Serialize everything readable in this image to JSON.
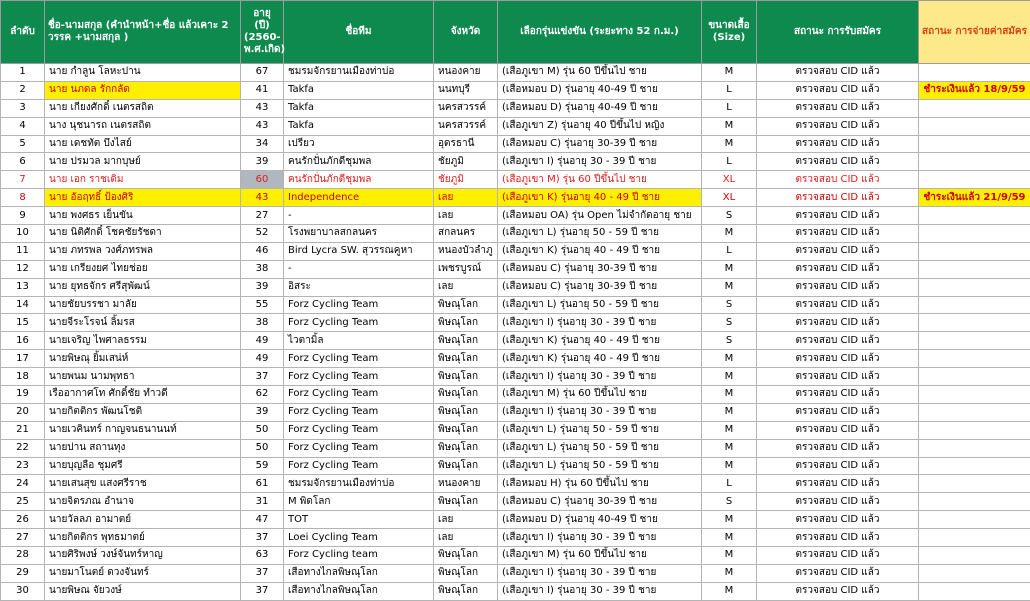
{
  "headers": [
    "ลำดับ",
    "ชื่อ-นามสกุล (คำนำหน้า+ชื่อ แล้วเคาะ 2 วรรค +นามสกุล )",
    "อายุ (ปี) (2560-พ.ศ.เกิด)",
    "ชื่อทีม",
    "จังหวัด",
    "เลือกรุ่นแข่งขัน (ระยะทาง 52 ก.ม.)",
    "ขนาดเสื้อ (Size)",
    "สถานะ การรับสมัคร",
    "สถานะ การจ่ายค่าสมัคร"
  ],
  "rows": [
    {
      "no": "1",
      "name": "นาย กำลูน  โลหะปาน",
      "age": "67",
      "team": "ชมรมจักรยานเมืองท่าบ่อ",
      "province": "หนองคาย",
      "category": "(เสือภูเขา M) รุ่น 60 ปีขึ้นไป ชาย",
      "size": "M",
      "status": "ตรวจสอบ CID แล้ว",
      "payment": "",
      "style": ""
    },
    {
      "no": "2",
      "name": "นาย นภดล  รักกลัด",
      "age": "41",
      "team": "Takfa",
      "province": "นนทบุรี",
      "category": "(เสือหมอบ D) รุ่นอายุ 40-49 ปี ชาย",
      "size": "L",
      "status": "ตรวจสอบ CID แล้ว",
      "payment": "ชำระเงินแล้ว 18/9/59",
      "style": "hl-name"
    },
    {
      "no": "3",
      "name": "นาย เกียงศักดิ์  เนตรสถิต",
      "age": "43",
      "team": "Takfa",
      "province": "นครสวรรค์",
      "category": "(เสือหมอบ D) รุ่นอายุ 40-49 ปี ชาย",
      "size": "L",
      "status": "ตรวจสอบ CID แล้ว",
      "payment": "",
      "style": ""
    },
    {
      "no": "4",
      "name": "นาง นุชนารถ  เนตรสถิต",
      "age": "43",
      "team": "Takfa",
      "province": "นครสวรรค์",
      "category": "(เสือภูเขา Z) รุ่นอายุ 40 ปีขึ้นไป หญิง",
      "size": "M",
      "status": "ตรวจสอบ CID แล้ว",
      "payment": "",
      "style": ""
    },
    {
      "no": "5",
      "name": "นาย เดชทัต  บึงไสย์",
      "age": "34",
      "team": "เปรียว",
      "province": "อุดรธานี",
      "category": "(เสือหมอบ C) รุ่นอายุ 30-39 ปี ชาย",
      "size": "M",
      "status": "ตรวจสอบ CID แล้ว",
      "payment": "",
      "style": ""
    },
    {
      "no": "6",
      "name": "นาย ปรมวล  มากบุษย์",
      "age": "39",
      "team": "คนรักปั่นภักดีชุมพล",
      "province": "ชัยภูมิ",
      "category": "(เสือภูเขา I) รุ่นอายุ 30 - 39 ปี ชาย",
      "size": "L",
      "status": "ตรวจสอบ CID แล้ว",
      "payment": "",
      "style": ""
    },
    {
      "no": "7",
      "name": "นาย เอก  ราชเดิม",
      "age": "60",
      "team": "คนรักปั่นภักดีชุมพล",
      "province": "ชัยภูมิ",
      "category": "(เสือภูเขา M) รุ่น 60 ปีขึ้นไป ชาย",
      "size": "XL",
      "status": "ตรวจสอบ CID แล้ว",
      "payment": "",
      "style": "red"
    },
    {
      "no": "8",
      "name": "นาย อัอฤทธิ์  ป้องศิริ",
      "age": "43",
      "team": "Independence",
      "province": "เลย",
      "category": "(เสือภูเขา K) รุ่นอายุ 40 - 49 ปี ชาย",
      "size": "XL",
      "status": "ตรวจสอบ CID แล้ว",
      "payment": "ชำระเงินแล้ว 21/9/59",
      "style": "hl"
    },
    {
      "no": "9",
      "name": "นาย พงศธร  เย็นขัน",
      "age": "27",
      "team": "-",
      "province": "เลย",
      "category": "(เสือหมอบ OA) รุ่น Open ไม่จำกัดอายุ ชาย",
      "size": "S",
      "status": "ตรวจสอบ CID แล้ว",
      "payment": "",
      "style": ""
    },
    {
      "no": "10",
      "name": "นาย นิติศักดิ์  โชคชัยรัชดา",
      "age": "52",
      "team": "โรงพยาบาลสกลนคร",
      "province": "สกลนคร",
      "category": "(เสือภูเขา L) รุ่นอายุ 50 - 59 ปี ชาย",
      "size": "M",
      "status": "ตรวจสอบ CID แล้ว",
      "payment": "",
      "style": ""
    },
    {
      "no": "11",
      "name": "นาย ภทรพล  วงศ์ภทรพล",
      "age": "46",
      "team": "Bird Lycra SW. สุวรรณคูหา",
      "province": "หนองบัวลำภู",
      "category": "(เสือภูเขา K) รุ่นอายุ 40 - 49 ปี ชาย",
      "size": "L",
      "status": "ตรวจสอบ CID แล้ว",
      "payment": "",
      "style": ""
    },
    {
      "no": "12",
      "name": "นาย เกรียงยศ  ไทยช่อย",
      "age": "38",
      "team": "-",
      "province": "เพชรบูรณ์",
      "category": "(เสือหมอบ C) รุ่นอายุ 30-39 ปี ชาย",
      "size": "M",
      "status": "ตรวจสอบ CID แล้ว",
      "payment": "",
      "style": ""
    },
    {
      "no": "13",
      "name": "นาย ยุทธจักร  ศรีสุพัฒน์",
      "age": "39",
      "team": "อิสระ",
      "province": "เลย",
      "category": "(เสือหมอบ C) รุ่นอายุ 30-39 ปี ชาย",
      "size": "M",
      "status": "ตรวจสอบ CID แล้ว",
      "payment": "",
      "style": ""
    },
    {
      "no": "14",
      "name": "นายชัยบรรชา  มาลัย",
      "age": "55",
      "team": "Forz  Cycling  Team",
      "province": "พิษณุโลก",
      "category": "(เสือภูเขา L) รุ่นอายุ 50 - 59 ปี ชาย",
      "size": "S",
      "status": "ตรวจสอบ CID แล้ว",
      "payment": "",
      "style": ""
    },
    {
      "no": "15",
      "name": "นายจีระโรจน์  ลิ้มรส",
      "age": "38",
      "team": "Forz  Cycling  Team",
      "province": "พิษณุโลก",
      "category": "(เสือภูเขา I) รุ่นอายุ 30 - 39 ปี ชาย",
      "size": "S",
      "status": "ตรวจสอบ CID แล้ว",
      "payment": "",
      "style": ""
    },
    {
      "no": "16",
      "name": "นายเจริญ  ไพศาลธรรม",
      "age": "49",
      "team": "ไวตามิ้ล",
      "province": "พิษณุโลก",
      "category": "(เสือภูเขา K) รุ่นอายุ 40 - 49 ปี ชาย",
      "size": "S",
      "status": "ตรวจสอบ CID แล้ว",
      "payment": "",
      "style": ""
    },
    {
      "no": "17",
      "name": "นายพิษณุ  ยิ้มเสน่ห์",
      "age": "49",
      "team": "Forz  Cycling  Team",
      "province": "พิษณุโลก",
      "category": "(เสือภูเขา K) รุ่นอายุ 40 - 49 ปี ชาย",
      "size": "M",
      "status": "ตรวจสอบ CID แล้ว",
      "payment": "",
      "style": ""
    },
    {
      "no": "18",
      "name": "นายพนม  นามพุทธา",
      "age": "37",
      "team": "Forz  Cycling  Team",
      "province": "พิษณุโลก",
      "category": "(เสือภูเขา I) รุ่นอายุ 30 - 39 ปี ชาย",
      "size": "M",
      "status": "ตรวจสอบ CID แล้ว",
      "payment": "",
      "style": ""
    },
    {
      "no": "19",
      "name": "เรืออากาศโท ศักดิ์ชัย  ทำวดี",
      "age": "62",
      "team": "Forz  Cycling  Team",
      "province": "พิษณุโลก",
      "category": "(เสือภูเขา M) รุ่น 60 ปีขึ้นไป ชาย",
      "size": "M",
      "status": "ตรวจสอบ CID แล้ว",
      "payment": "",
      "style": ""
    },
    {
      "no": "20",
      "name": "นายกิตติกร  พัฒนโชติ",
      "age": "39",
      "team": "Forz  Cycling  Team",
      "province": "พิษณุโลก",
      "category": "(เสือภูเขา I) รุ่นอายุ 30 - 39 ปี ชาย",
      "size": "M",
      "status": "ตรวจสอบ CID แล้ว",
      "payment": "",
      "style": ""
    },
    {
      "no": "21",
      "name": "นายเวคินทร์  กาญจนธนานนท์",
      "age": "50",
      "team": "Forz  Cycling  Team",
      "province": "พิษณุโลก",
      "category": "(เสือภูเขา L) รุ่นอายุ 50 - 59 ปี ชาย",
      "size": "M",
      "status": "ตรวจสอบ CID แล้ว",
      "payment": "",
      "style": ""
    },
    {
      "no": "22",
      "name": "นายปาน  สถานทุง",
      "age": "50",
      "team": "Forz  Cycling  Team",
      "province": "พิษณุโลก",
      "category": "(เสือภูเขา L) รุ่นอายุ 50 - 59 ปี ชาย",
      "size": "M",
      "status": "ตรวจสอบ CID แล้ว",
      "payment": "",
      "style": ""
    },
    {
      "no": "23",
      "name": "นายบุญลือ  ชุมศรี",
      "age": "59",
      "team": "Forz  Cycling  Team",
      "province": "พิษณุโลก",
      "category": "(เสือภูเขา L) รุ่นอายุ 50 - 59 ปี ชาย",
      "size": "M",
      "status": "ตรวจสอบ CID แล้ว",
      "payment": "",
      "style": ""
    },
    {
      "no": "24",
      "name": "นายเสนสุข  แสงศรีราช",
      "age": "61",
      "team": "ชมรมจักรยานเมืองท่าบ่อ",
      "province": "หนองคาย",
      "category": "(เสือหมอบ H) รุ่น 60 ปีขึ้นไป ชาย",
      "size": "L",
      "status": "ตรวจสอบ CID แล้ว",
      "payment": "",
      "style": ""
    },
    {
      "no": "25",
      "name": "นายจิตรภณ  อำนาจ",
      "age": "31",
      "team": "M พิดโลก",
      "province": "พิษณุโลก",
      "category": "(เสือหมอบ C) รุ่นอายุ 30-39 ปี ชาย",
      "size": "S",
      "status": "ตรวจสอบ CID แล้ว",
      "payment": "",
      "style": ""
    },
    {
      "no": "26",
      "name": "นายวัลลภ  อามาตย์",
      "age": "47",
      "team": "TOT",
      "province": "เลย",
      "category": "(เสือหมอบ D) รุ่นอายุ 40-49 ปี ชาย",
      "size": "M",
      "status": "ตรวจสอบ CID แล้ว",
      "payment": "",
      "style": ""
    },
    {
      "no": "27",
      "name": "นายกิตติกร  พุทธมาตย์",
      "age": "37",
      "team": "Loei Cycling Team",
      "province": "เลย",
      "category": "(เสือภูเขา I) รุ่นอายุ 30 - 39 ปี ชาย",
      "size": "M",
      "status": "ตรวจสอบ CID แล้ว",
      "payment": "",
      "style": ""
    },
    {
      "no": "28",
      "name": "นายศิริพงษ์  วงษ์จันทร์หาญ",
      "age": "63",
      "team": "Forz Cycling team",
      "province": "พิษณุโลก",
      "category": "(เสือภูเขา M) รุ่น 60 ปีขึ้นไป ชาย",
      "size": "M",
      "status": "ตรวจสอบ CID แล้ว",
      "payment": "",
      "style": ""
    },
    {
      "no": "29",
      "name": "นายมาโนตย์  ดวงจันทร์",
      "age": "37",
      "team": "เสือทางไกลพิษณุโลก",
      "province": "พิษณุโลก",
      "category": "(เสือภูเขา I) รุ่นอายุ 30 - 39 ปี ชาย",
      "size": "M",
      "status": "ตรวจสอบ CID แล้ว",
      "payment": "",
      "style": ""
    },
    {
      "no": "30",
      "name": "นายพิษณ  จัยวงษ์",
      "age": "37",
      "team": "เสือทางไกลพิษณุโลก",
      "province": "พิษณุโลก",
      "category": "(เสือภูเขา I) รุ่นอายุ 30 - 39 ปี ชาย",
      "size": "M",
      "status": "ตรวจสอบ CID แล้ว",
      "payment": "",
      "style": ""
    }
  ]
}
